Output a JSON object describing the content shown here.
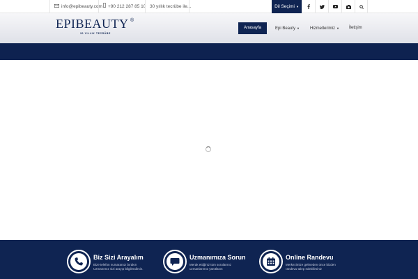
{
  "topbar": {
    "email": "info@epibeauty.com",
    "phone": "+90 212 287 85 10",
    "tagline": "30 yıllık tecrübe ile...",
    "language_button": "Dil Seçimi",
    "social": [
      "facebook-icon",
      "twitter-icon",
      "youtube-icon",
      "instagram-icon",
      "search-icon"
    ]
  },
  "logo": {
    "text": "EPIBEAUTY",
    "registered": "®",
    "subtitle": "30 YILLIK TECRÜBE"
  },
  "nav": {
    "items": [
      {
        "label": "Anasayfa",
        "active": true,
        "dropdown": false
      },
      {
        "label": "Epi Beauty",
        "active": false,
        "dropdown": true
      },
      {
        "label": "Hizmetlerimiz",
        "active": false,
        "dropdown": true
      },
      {
        "label": "İletişim",
        "active": false,
        "dropdown": false
      }
    ]
  },
  "footer": {
    "blocks": [
      {
        "icon": "phone-icon",
        "title": "Biz Sizi Arayalım",
        "desc": "Bize telefon numaranızı bırakın Uzmanımız sizi arayıp bilgilendirsin."
      },
      {
        "icon": "chat-icon",
        "title": "Uzmanımıza Sorun",
        "desc": "Merak ettiğiniz tüm sorularınız uzmanlarımız yanıtlasın"
      },
      {
        "icon": "calendar-icon",
        "title": "Online Randevu",
        "desc": "Merkezimize gelmeden önce bizden randevu talep edebilirsiniz"
      }
    ]
  },
  "colors": {
    "brand_navy": "#0f2452",
    "white": "#ffffff"
  }
}
